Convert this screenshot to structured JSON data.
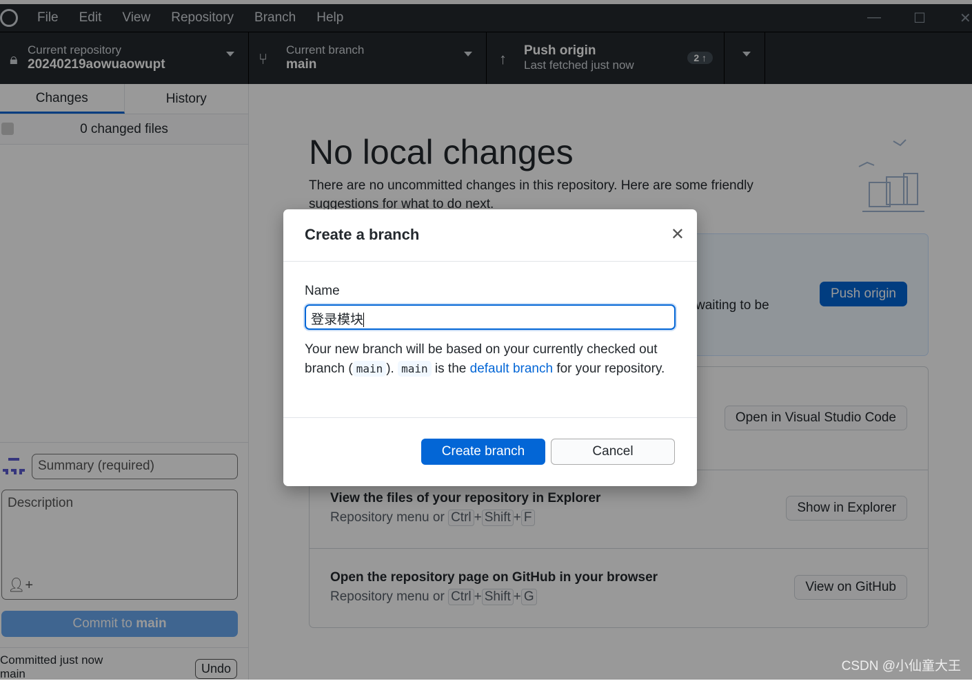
{
  "menu": [
    "File",
    "Edit",
    "View",
    "Repository",
    "Branch",
    "Help"
  ],
  "toolbar": {
    "repo_label": "Current repository",
    "repo_name": "20240219aowuaowupt",
    "branch_label": "Current branch",
    "branch_name": "main",
    "push_title": "Push origin",
    "push_sub": "Last fetched just now",
    "push_count": "2 ↑"
  },
  "sidebar": {
    "tabs": [
      "Changes",
      "History"
    ],
    "changed_files": "0 changed files",
    "summary_placeholder": "Summary (required)",
    "description_placeholder": "Description",
    "commit_prefix": "Commit to ",
    "commit_branch": "main",
    "last_commit": "Committed just now",
    "last_commit_branch": "main",
    "undo": "Undo"
  },
  "main": {
    "title": "No local changes",
    "lead": "There are no uncommitted changes in this repository. Here are some friendly suggestions for what to do next.",
    "push_partial": "waiting to be",
    "push_button": "Push origin",
    "vscode_button": "Open in Visual Studio Code",
    "explorer_title": "View the files of your repository in Explorer",
    "explorer_sub": "Repository menu or",
    "explorer_keys": [
      "Ctrl",
      "Shift",
      "F"
    ],
    "explorer_button": "Show in Explorer",
    "github_title": "Open the repository page on GitHub in your browser",
    "github_sub": "Repository menu or",
    "github_keys": [
      "Ctrl",
      "Shift",
      "G"
    ],
    "github_button": "View on GitHub"
  },
  "modal": {
    "title": "Create a branch",
    "name_label": "Name",
    "name_value": "登录模块",
    "text1": "Your new branch will be based on your currently checked out branch (",
    "code1": "main",
    "text2": "). ",
    "code2": "main",
    "text3": " is the ",
    "link": "default branch",
    "text4": " for your repository.",
    "create": "Create branch",
    "cancel": "Cancel"
  },
  "watermark": "CSDN @小仙童大王",
  "colors": {
    "accent": "#0366d6",
    "toolbar": "#24292e"
  }
}
